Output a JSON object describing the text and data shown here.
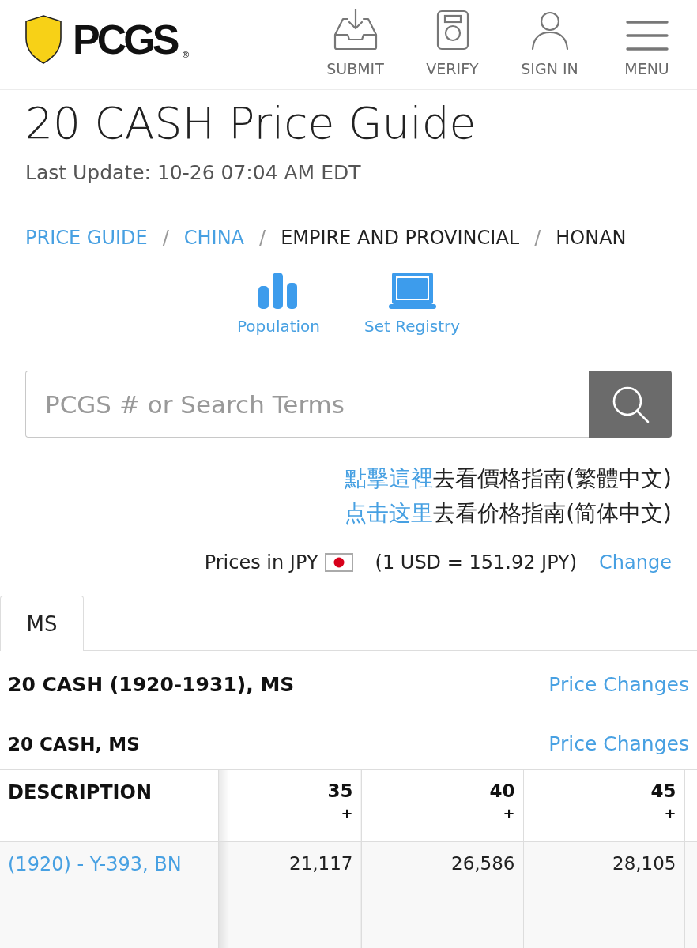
{
  "header": {
    "logo": {
      "text": "PCGS",
      "mark": "®"
    },
    "nav": [
      {
        "label": "SUBMIT",
        "kind": "inbox"
      },
      {
        "label": "VERIFY",
        "kind": "device"
      },
      {
        "label": "SIGN IN",
        "kind": "person"
      },
      {
        "label": "MENU",
        "kind": "menu"
      }
    ]
  },
  "title": "20 CASH Price Guide",
  "last_update": "Last Update: 10-26 07:04 AM EDT",
  "breadcrumb": [
    {
      "label": "PRICE GUIDE",
      "link": true
    },
    {
      "separator": "/",
      "label": "CHINA",
      "link": true
    },
    {
      "separator": "/",
      "label": "EMPIRE AND PROVINCIAL",
      "link": false
    },
    {
      "separator": "/",
      "label": "HONAN",
      "link": false
    }
  ],
  "quick_links": [
    {
      "label": "Population",
      "kind": "bars"
    },
    {
      "label": "Set Registry",
      "kind": "laptop"
    }
  ],
  "search": {
    "placeholder": "PCGS # or Search Terms"
  },
  "language_links": [
    {
      "link": "點擊這裡",
      "text": "去看價格指南(繁體中文)"
    },
    {
      "link": "点击这里",
      "text": "去看价格指南(简体中文)"
    }
  ],
  "currency": {
    "label": "Prices in JPY",
    "rate": "(1 USD = 151.92 JPY)",
    "action": "Change"
  },
  "tabs": [
    {
      "label": "MS",
      "selected": true
    }
  ],
  "group": {
    "title": "20 CASH (1920-1931), MS",
    "action": "Price Changes"
  },
  "subgroup": {
    "title": "20 CASH, MS",
    "action": "Price Changes"
  },
  "table": {
    "columns": [
      {
        "label": "DESCRIPTION"
      },
      {
        "label": "35",
        "suffix": "+"
      },
      {
        "label": "40",
        "suffix": "+"
      },
      {
        "label": "45",
        "suffix": "+"
      }
    ],
    "rows": [
      {
        "cells": [
          "(1920) - Y-393, BN",
          "21,117",
          "26,586",
          "28,105"
        ]
      }
    ]
  }
}
